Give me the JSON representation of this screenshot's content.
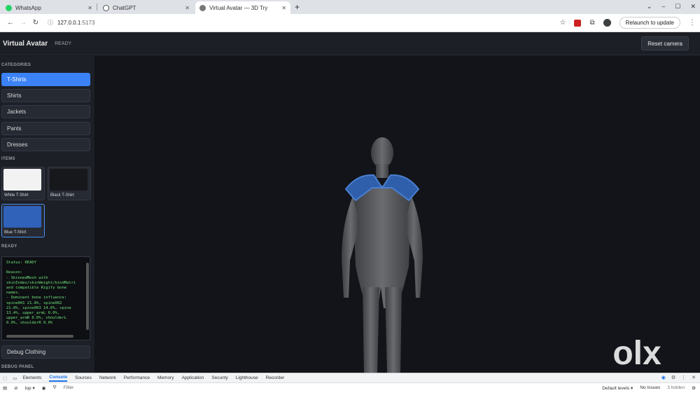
{
  "browser": {
    "tabs": [
      {
        "title": "WhatsApp",
        "color": "#25d366"
      },
      {
        "title": "ChatGPT",
        "color": "#555555"
      },
      {
        "title": "Virtual Avatar — 3D Try",
        "color": "#666666"
      }
    ],
    "url_host": "127.0.0.1",
    "url_port": ":5173",
    "relaunch_label": "Relaunch to update"
  },
  "app": {
    "title": "Virtual Avatar",
    "status": "READY",
    "reset_label": "Reset camera"
  },
  "sidebar": {
    "categories_heading": "CATEGORIES",
    "categories": [
      "T-Shirts",
      "Shirts",
      "Jackets",
      "Pants",
      "Dresses"
    ],
    "active_category": "T-Shirts",
    "items_heading": "ITEMS",
    "items": [
      {
        "label": "White T-Shirt",
        "color": "#f2f2f2"
      },
      {
        "label": "Black T-Shirt",
        "color": "#17181b"
      },
      {
        "label": "Blue T-Shirt",
        "color": "#2f62b8"
      }
    ],
    "active_item": "Blue T-Shirt",
    "status_heading": "READY",
    "log_text": "Status: READY\n\nReason:\n- SkinnedMesh with\nskinIndex/skinWeight/bindMatri\nand compatible Rigify bone\nnames.\n- Dominant bone influence:\nspine001 21.8%, spine002\n21.0%, spine003 14.6%, spine\n13.4%, upper_armL 0.0%,\nupper_armR 0.0%, shoulderL\n0.0%, shoulderR 0.0%",
    "debug_button": "Debug Clothing",
    "debug_heading": "DEBUG PANEL"
  },
  "viewport": {
    "background": "#121419",
    "avatar_color": "#5a5c60",
    "garment_color": "#2f5faa",
    "watermark": "olx"
  },
  "devtools": {
    "tabs": [
      "Elements",
      "Console",
      "Sources",
      "Network",
      "Performance",
      "Memory",
      "Application",
      "Security",
      "Lighthouse",
      "Recorder"
    ],
    "active_tab": "Console",
    "context": "top",
    "filter_placeholder": "Filter",
    "levels": "Default levels",
    "issues": "No Issues",
    "hidden": "3 hidden"
  }
}
